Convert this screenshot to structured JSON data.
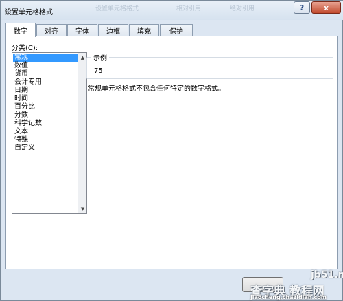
{
  "titlebar": {
    "title": "设置单元格格式",
    "faint_text": [
      "设置单元格格式",
      "相对引用",
      "绝对引用"
    ],
    "help_label": "?",
    "close_label": "x"
  },
  "tabs": [
    {
      "label": "数字",
      "active": true
    },
    {
      "label": "对齐",
      "active": false
    },
    {
      "label": "字体",
      "active": false
    },
    {
      "label": "边框",
      "active": false
    },
    {
      "label": "填充",
      "active": false
    },
    {
      "label": "保护",
      "active": false
    }
  ],
  "category": {
    "label": "分类(C):",
    "items": [
      "常规",
      "数值",
      "货币",
      "会计专用",
      "日期",
      "时间",
      "百分比",
      "分数",
      "科学记数",
      "文本",
      "特殊",
      "自定义"
    ],
    "selected": "常规"
  },
  "sample": {
    "legend": "示例",
    "value": "75"
  },
  "description": "常规单元格格式不包含任何特定的数字格式。",
  "watermark": {
    "site": "jb51.net",
    "main": "查字典 教程网",
    "url": "jiaocheng.chazidian.com"
  }
}
